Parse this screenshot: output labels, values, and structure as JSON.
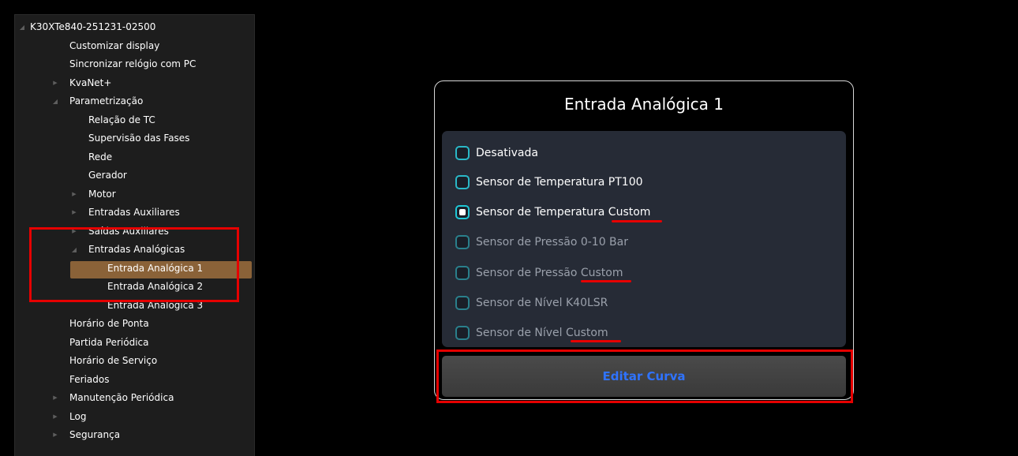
{
  "tree": {
    "items": [
      {
        "label": "K30XTe840-251231-02500",
        "arrow": "expanded"
      },
      {
        "label": "Customizar display",
        "arrow": "none"
      },
      {
        "label": "Sincronizar relógio com PC",
        "arrow": "none"
      },
      {
        "label": "KvaNet+",
        "arrow": "collapsed"
      },
      {
        "label": "Parametrização",
        "arrow": "expanded"
      },
      {
        "label": "Relação de TC",
        "arrow": "none"
      },
      {
        "label": "Supervisão das Fases",
        "arrow": "none"
      },
      {
        "label": "Rede",
        "arrow": "none"
      },
      {
        "label": "Gerador",
        "arrow": "none"
      },
      {
        "label": "Motor",
        "arrow": "collapsed"
      },
      {
        "label": "Entradas Auxiliares",
        "arrow": "collapsed"
      },
      {
        "label": "Saídas Auxiliares",
        "arrow": "collapsed"
      },
      {
        "label": "Entradas Analógicas",
        "arrow": "expanded"
      },
      {
        "label": "Entrada Analógica 1",
        "arrow": "none",
        "selected": true
      },
      {
        "label": "Entrada Analógica 2",
        "arrow": "none"
      },
      {
        "label": "Entrada Analógica 3",
        "arrow": "none"
      },
      {
        "label": "Horário de Ponta",
        "arrow": "none"
      },
      {
        "label": "Partida Periódica",
        "arrow": "none"
      },
      {
        "label": "Horário de Serviço",
        "arrow": "none"
      },
      {
        "label": "Feriados",
        "arrow": "none"
      },
      {
        "label": "Manutenção Periódica",
        "arrow": "collapsed"
      },
      {
        "label": "Log",
        "arrow": "collapsed"
      },
      {
        "label": "Segurança",
        "arrow": "collapsed"
      }
    ]
  },
  "dialog": {
    "title": "Entrada Analógica 1",
    "options": [
      {
        "label": "Desativada",
        "checked": false,
        "enabled": true
      },
      {
        "label": "Sensor de Temperatura PT100",
        "checked": false,
        "enabled": true
      },
      {
        "label": "Sensor de Temperatura Custom",
        "checked": true,
        "enabled": true
      },
      {
        "label": "Sensor de Pressão 0-10 Bar",
        "checked": false,
        "enabled": false
      },
      {
        "label": "Sensor de Pressão Custom",
        "checked": false,
        "enabled": false
      },
      {
        "label": "Sensor de Nível K40LSR",
        "checked": false,
        "enabled": false
      },
      {
        "label": "Sensor de Nível Custom",
        "checked": false,
        "enabled": false
      }
    ],
    "edit_button_label": "Editar Curva"
  },
  "colors": {
    "selected_item_bg": "#8a6238",
    "highlight_red": "#e60000",
    "radio_accent": "#2ab8c7",
    "button_text": "#2f73ff"
  }
}
